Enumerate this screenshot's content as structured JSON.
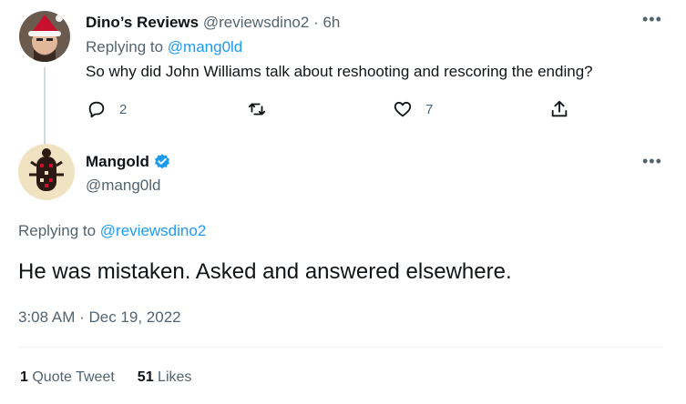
{
  "parent_tweet": {
    "author_name": "Dino’s Reviews",
    "author_handle": "@reviewsdino2",
    "separator": "·",
    "time": "6h",
    "replying_prefix": "Replying to",
    "replying_to": "@mang0ld",
    "text": "So why did John Williams talk about reshooting and rescoring the ending?",
    "reply_count": "2",
    "like_count": "7",
    "more_label": "•••"
  },
  "main_tweet": {
    "author_name": "Mangold",
    "author_handle": "@mang0ld",
    "verified": true,
    "replying_prefix": "Replying to",
    "replying_to": "@reviewsdino2",
    "text": "He was mistaken. Asked and answered elsewhere.",
    "timestamp": "3:08 AM · Dec 19, 2022",
    "quote_count": "1",
    "quote_label": "Quote Tweet",
    "like_count": "51",
    "like_label": "Likes",
    "more_label": "•••"
  },
  "colors": {
    "accent": "#1d9bf0",
    "muted": "#536471",
    "text": "#0f1419"
  },
  "icons": {
    "reply": "reply-icon",
    "retweet": "retweet-icon",
    "like": "heart-icon",
    "share": "share-icon",
    "more": "more-icon",
    "verified": "verified-badge-icon"
  }
}
